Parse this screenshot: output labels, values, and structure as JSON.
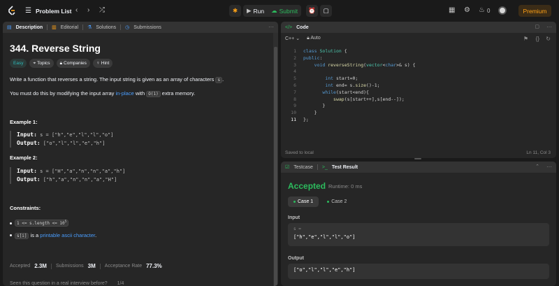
{
  "topbar": {
    "problem_list": "Problem List",
    "run": "Run",
    "submit": "Submit",
    "streak_count": "0",
    "premium": "Premium"
  },
  "description_tabs": [
    "Description",
    "Editorial",
    "Solutions",
    "Submissions"
  ],
  "problem": {
    "title": "344. Reverse String",
    "tags": [
      "Easy",
      "Topics",
      "Companies",
      "Hint"
    ],
    "para1_a": "Write a function that reverses a string. The input string is given as an array of characters ",
    "para1_code": "s",
    "para1_b": ".",
    "para2_a": "You must do this by modifying the input array ",
    "para2_link": "in-place",
    "para2_b": " with ",
    "para2_code": "O(1)",
    "para2_c": " extra memory.",
    "examples": [
      {
        "title": "Example 1:",
        "input_label": "Input:",
        "input": " s = [\"h\",\"e\",\"l\",\"l\",\"o\"]",
        "output_label": "Output:",
        "output": " [\"o\",\"l\",\"l\",\"e\",\"h\"]"
      },
      {
        "title": "Example 2:",
        "input_label": "Input:",
        "input": " s = [\"H\",\"a\",\"n\",\"n\",\"a\",\"h\"]",
        "output_label": "Output:",
        "output": " [\"h\",\"a\",\"n\",\"n\",\"a\",\"H\"]"
      }
    ],
    "constraints_title": "Constraints:",
    "constraint1": "1 <= s.length <= 10",
    "constraint1_sup": "5",
    "constraint2_code": "s[i]",
    "constraint2_a": " is a ",
    "constraint2_link": "printable ascii character",
    "constraint2_b": ".",
    "stats": {
      "accepted_label": "Accepted",
      "accepted": "2.3M",
      "submissions_label": "Submissions",
      "submissions": "3M",
      "rate_label": "Acceptance Rate",
      "rate": "77.3%"
    },
    "seen_q": "Seen this question in a real interview before?",
    "seen_page": "1/4"
  },
  "code": {
    "header": "Code",
    "language": "C++",
    "mode": "Auto",
    "line_numbers": [
      "1",
      "2",
      "3",
      "4",
      "5",
      "6",
      "7",
      "8",
      "9",
      "10",
      "11"
    ],
    "status": "Saved to local",
    "cursor": "Ln 11, Col 3"
  },
  "result": {
    "tab_testcase": "Testcase",
    "tab_result": "Test Result",
    "status": "Accepted",
    "runtime": "Runtime: 0 ms",
    "cases": [
      "Case 1",
      "Case 2"
    ],
    "input_label": "Input",
    "input_var": "s =",
    "input_value": "[\"h\",\"e\",\"l\",\"l\",\"o\"]",
    "output_label": "Output",
    "output_value": "[\"o\",\"l\",\"l\",\"e\",\"h\"]"
  },
  "colors": {
    "accent": "#ffa116",
    "accepted": "#2cbb5d",
    "link": "#4a9eff"
  }
}
